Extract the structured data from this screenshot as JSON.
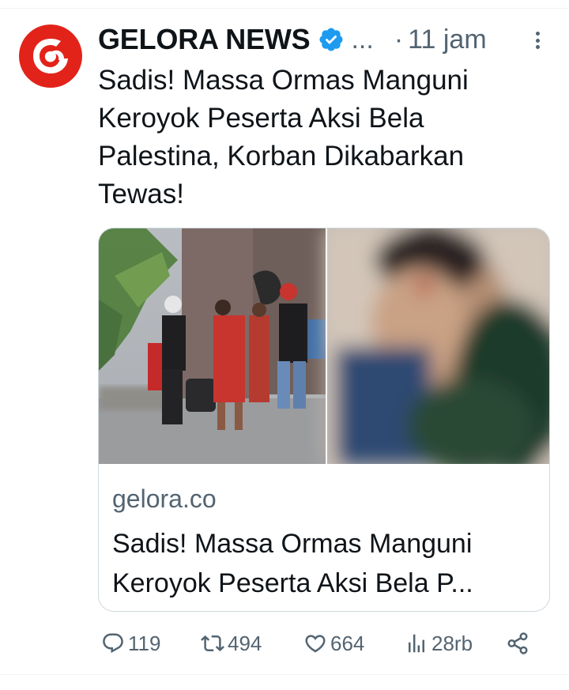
{
  "account": {
    "display_name": "GELORA NEWS",
    "name_overflow": "...",
    "separator": "·",
    "time": "11 jam",
    "avatar_icon": "gelora-logo",
    "brand_color": "#e2231a",
    "verified_color": "#1d9bf0"
  },
  "tweet": {
    "text": "Sadis! Massa Ormas Manguni Keroyok Peserta Aksi Bela Palestina, Korban Dikabarkan Tewas!"
  },
  "card": {
    "domain": "gelora.co",
    "title": "Sadis! Massa Ormas Manguni Keroyok Peserta Aksi Bela P..."
  },
  "actions": {
    "reply": {
      "icon": "reply-icon",
      "count": "119"
    },
    "retweet": {
      "icon": "retweet-icon",
      "count": "494"
    },
    "like": {
      "icon": "heart-icon",
      "count": "664"
    },
    "views": {
      "icon": "views-icon",
      "count": "28rb"
    },
    "share": {
      "icon": "share-icon"
    }
  }
}
